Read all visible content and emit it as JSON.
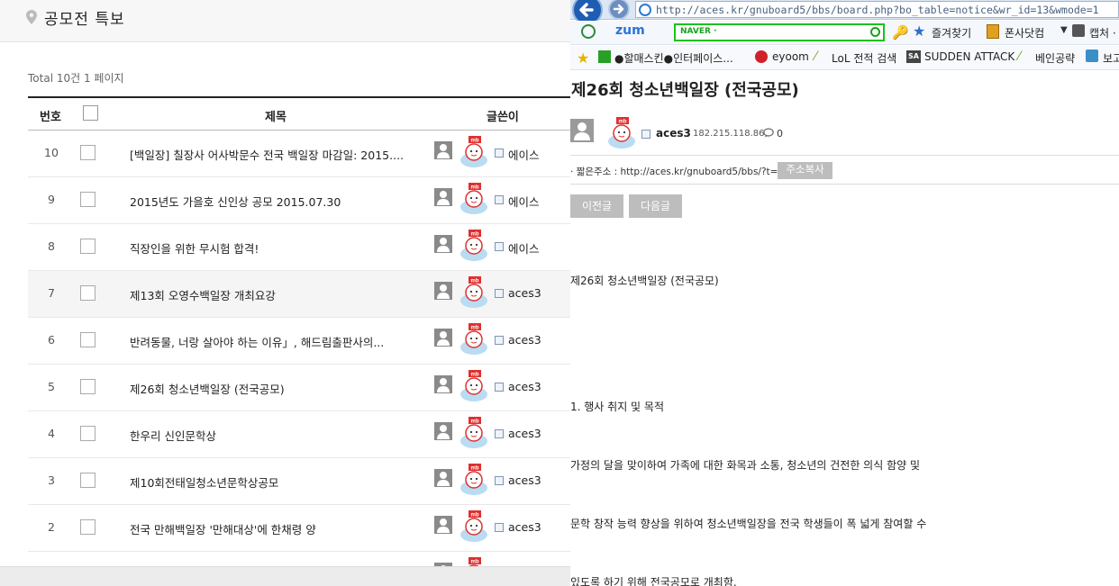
{
  "board": {
    "title": "공모전 특보",
    "total": "Total 10건 1 페이지",
    "headers": {
      "num": "번호",
      "subject": "제목",
      "author": "글쓴이"
    },
    "rows": [
      {
        "num": "10",
        "subject": "[백일장] 칠장사 어사박문수 전국 백일장 마감일: 2015....",
        "author": "에이스"
      },
      {
        "num": "9",
        "subject": "2015년도 가을호 신인상 공모 2015.07.30",
        "author": "에이스"
      },
      {
        "num": "8",
        "subject": "직장인을 위한 무시험 합격!",
        "author": "에이스"
      },
      {
        "num": "7",
        "subject": "제13회 오영수백일장 개최요강",
        "author": "aces3"
      },
      {
        "num": "6",
        "subject": "반려동물, 너랑 살아야 하는 이유」, 해드림출판사의...",
        "author": "aces3"
      },
      {
        "num": "5",
        "subject": "제26회 청소년백일장 (전국공모)",
        "author": "aces3"
      },
      {
        "num": "4",
        "subject": "한우리 신인문학상",
        "author": "aces3"
      },
      {
        "num": "3",
        "subject": "제10회전태일청소년문학상공모",
        "author": "aces3"
      },
      {
        "num": "2",
        "subject": "전국 만해백일장 '만해대상'에 한채령 양",
        "author": "aces3"
      }
    ]
  },
  "browser": {
    "url": "http://aces.kr/gnuboard5/bbs/board.php?bo_table=notice&wr_id=13&wmode=1",
    "search_brand": "NAVER ·",
    "zum": "zum",
    "favorites": "즐겨찾기",
    "ponsadak": "폰사닷컴",
    "capture": "캡처 ·",
    "bookmarks": [
      "●할매스킨●인터페이스...",
      "eyoom",
      "LoL 전적 검색",
      "SUDDEN ATTACK",
      "베인공략",
      "보고"
    ]
  },
  "post": {
    "title": "제26회 청소년백일장 (전국공모)",
    "author": "aces3",
    "ip": "182.215.118.86",
    "comments": "0",
    "short_label": "· 짧은주소 : http://aces.kr/gnuboard5/bbs/?t=8F",
    "copy_btn": "주소복사",
    "prev_btn": "이전글",
    "next_btn": "다음글",
    "body": [
      "제26회 청소년백일장 (전국공모)",
      "1. 행사 취지 및 목적",
      " 가정의 달을 맞이하여 가족에 대한 화목과 소통, 청소년의 건전한 의식 함양 및",
      "문학 창작 능력 향상을 위하여 청소년백일장을 전국 학생들이 폭 넓게 참여할 수",
      "있도록 하기 위해 전국공모로 개최함."
    ]
  }
}
